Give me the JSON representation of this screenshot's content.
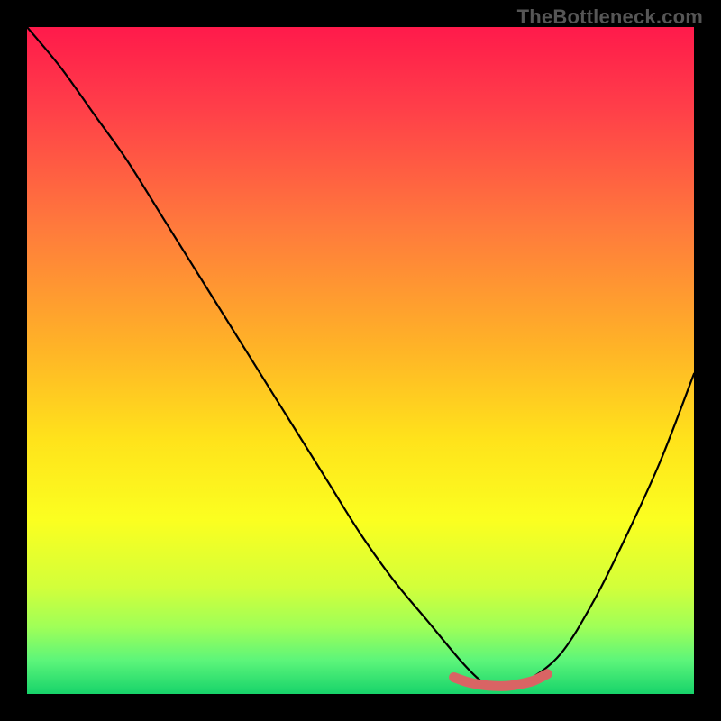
{
  "watermark": "TheBottleneck.com",
  "chart_data": {
    "type": "line",
    "title": "",
    "xlabel": "",
    "ylabel": "",
    "xlim": [
      0,
      100
    ],
    "ylim": [
      0,
      100
    ],
    "grid": false,
    "series": [
      {
        "name": "bottleneck-curve",
        "x": [
          0,
          5,
          10,
          15,
          20,
          25,
          30,
          35,
          40,
          45,
          50,
          55,
          60,
          65,
          68,
          70,
          72,
          75,
          80,
          85,
          90,
          95,
          100
        ],
        "y": [
          100,
          94,
          87,
          80,
          72,
          64,
          56,
          48,
          40,
          32,
          24,
          17,
          11,
          5,
          2,
          1,
          1,
          2,
          6,
          14,
          24,
          35,
          48
        ]
      },
      {
        "name": "optimal-zone-marker",
        "x": [
          64,
          66,
          68,
          70,
          72,
          74,
          76,
          78
        ],
        "y": [
          2.5,
          1.8,
          1.4,
          1.2,
          1.2,
          1.5,
          2.0,
          3.0
        ]
      }
    ],
    "gradient_stops": [
      {
        "offset": 0.0,
        "color": "#ff1a4b"
      },
      {
        "offset": 0.12,
        "color": "#ff3e49"
      },
      {
        "offset": 0.3,
        "color": "#ff7a3c"
      },
      {
        "offset": 0.48,
        "color": "#ffb327"
      },
      {
        "offset": 0.62,
        "color": "#ffe31b"
      },
      {
        "offset": 0.74,
        "color": "#fbff20"
      },
      {
        "offset": 0.84,
        "color": "#d2ff3a"
      },
      {
        "offset": 0.9,
        "color": "#9fff58"
      },
      {
        "offset": 0.95,
        "color": "#5cf57a"
      },
      {
        "offset": 1.0,
        "color": "#17d36a"
      }
    ],
    "marker_color": "#d96464"
  }
}
